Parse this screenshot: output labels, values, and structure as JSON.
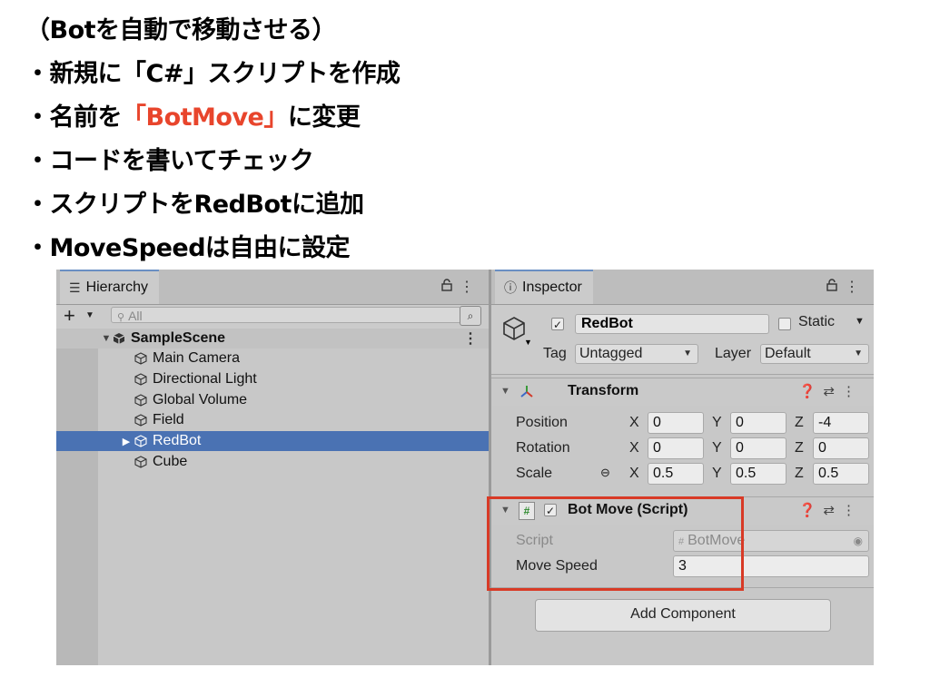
{
  "slide": {
    "line1": "（Botを自動で移動させる）",
    "line2": "・新規に「C#」スクリプトを作成",
    "line3_pre": "・名前を",
    "line3_hl": "「BotMove」",
    "line3_post": "に変更",
    "line4": "・コードを書いてチェック",
    "line5": "・スクリプトをRedBotに追加",
    "line6": "・MoveSpeedは自由に設定",
    "highlight_color": "#e8452c"
  },
  "hierarchy": {
    "tab_label": "Hierarchy",
    "search_placeholder": "All",
    "scene": "SampleScene",
    "items": [
      "Main Camera",
      "Directional Light",
      "Global Volume",
      "Field",
      "RedBot",
      "Cube"
    ],
    "selected": "RedBot"
  },
  "inspector": {
    "tab_label": "Inspector",
    "object_name": "RedBot",
    "static_label": "Static",
    "tag_label": "Tag",
    "tag_value": "Untagged",
    "layer_label": "Layer",
    "layer_value": "Default",
    "transform": {
      "title": "Transform",
      "position_label": "Position",
      "rotation_label": "Rotation",
      "scale_label": "Scale",
      "position": {
        "x": "0",
        "y": "0",
        "z": "-4"
      },
      "rotation": {
        "x": "0",
        "y": "0",
        "z": "0"
      },
      "scale": {
        "x": "0.5",
        "y": "0.5",
        "z": "0.5"
      }
    },
    "botmove": {
      "title": "Bot Move (Script)",
      "script_label": "Script",
      "script_value": "BotMove",
      "speed_label": "Move Speed",
      "speed_value": "3"
    },
    "add_component": "Add Component"
  },
  "axes": {
    "x": "X",
    "y": "Y",
    "z": "Z"
  },
  "colors": {
    "selection": "#4a72b3",
    "callout": "#d83a26"
  }
}
